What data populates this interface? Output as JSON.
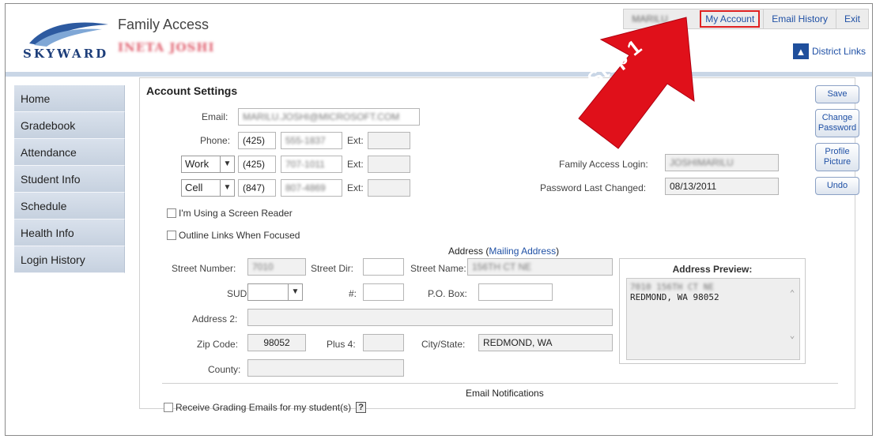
{
  "header": {
    "app_title": "Family Access",
    "user_name": "INETA JOSHI",
    "logo_text": "SKYWARD",
    "top_links": {
      "user": "MARILU JOSHI",
      "my_account": "My Account",
      "email_history": "Email History",
      "exit": "Exit"
    },
    "district_links": "District Links"
  },
  "sidebar": {
    "items": [
      {
        "label": "Home"
      },
      {
        "label": "Gradebook"
      },
      {
        "label": "Attendance"
      },
      {
        "label": "Student Info"
      },
      {
        "label": "Schedule"
      },
      {
        "label": "Health Info"
      },
      {
        "label": "Login History"
      }
    ]
  },
  "account": {
    "title": "Account Settings",
    "email_label": "Email:",
    "email_value": "MARILU.JOSHI@MICROSOFT.COM",
    "phone_label": "Phone:",
    "ext_label": "Ext:",
    "phones": [
      {
        "type": "",
        "area": "(425)",
        "number": "555-1837"
      },
      {
        "type": "Work",
        "area": "(425)",
        "number": "707-1011"
      },
      {
        "type": "Cell",
        "area": "(847)",
        "number": "807-4869"
      }
    ],
    "family_login_label": "Family Access Login:",
    "family_login_value": "JOSHIMARILU",
    "pwd_changed_label": "Password Last Changed:",
    "pwd_changed_value": "08/13/2011",
    "screen_reader": "I'm Using a Screen Reader",
    "outline_links": "Outline Links When Focused"
  },
  "address": {
    "heading": "Address",
    "mailing_link": "Mailing Address",
    "street_number_label": "Street Number:",
    "street_number_value": "7010",
    "street_dir_label": "Street Dir:",
    "street_name_label": "Street Name:",
    "street_name_value": "156TH CT NE",
    "sud_label": "SUD:",
    "hash_label": "#:",
    "po_box_label": "P.O. Box:",
    "address2_label": "Address 2:",
    "zip_label": "Zip Code:",
    "zip_value": "98052",
    "plus4_label": "Plus 4:",
    "city_label": "City/State:",
    "city_value": "REDMOND, WA",
    "county_label": "County:",
    "preview_title": "Address Preview:",
    "preview_line1": "7010 156TH CT NE",
    "preview_line2": "REDMOND, WA 98052"
  },
  "notifications": {
    "heading": "Email Notifications",
    "grading": "Receive Grading Emails for my student(s)",
    "help": "?"
  },
  "buttons": {
    "save": "Save",
    "change_password": "Change Password",
    "profile_picture": "Profile Picture",
    "undo": "Undo"
  },
  "callout": {
    "text": "Step 1",
    "color": "#e0101a"
  }
}
